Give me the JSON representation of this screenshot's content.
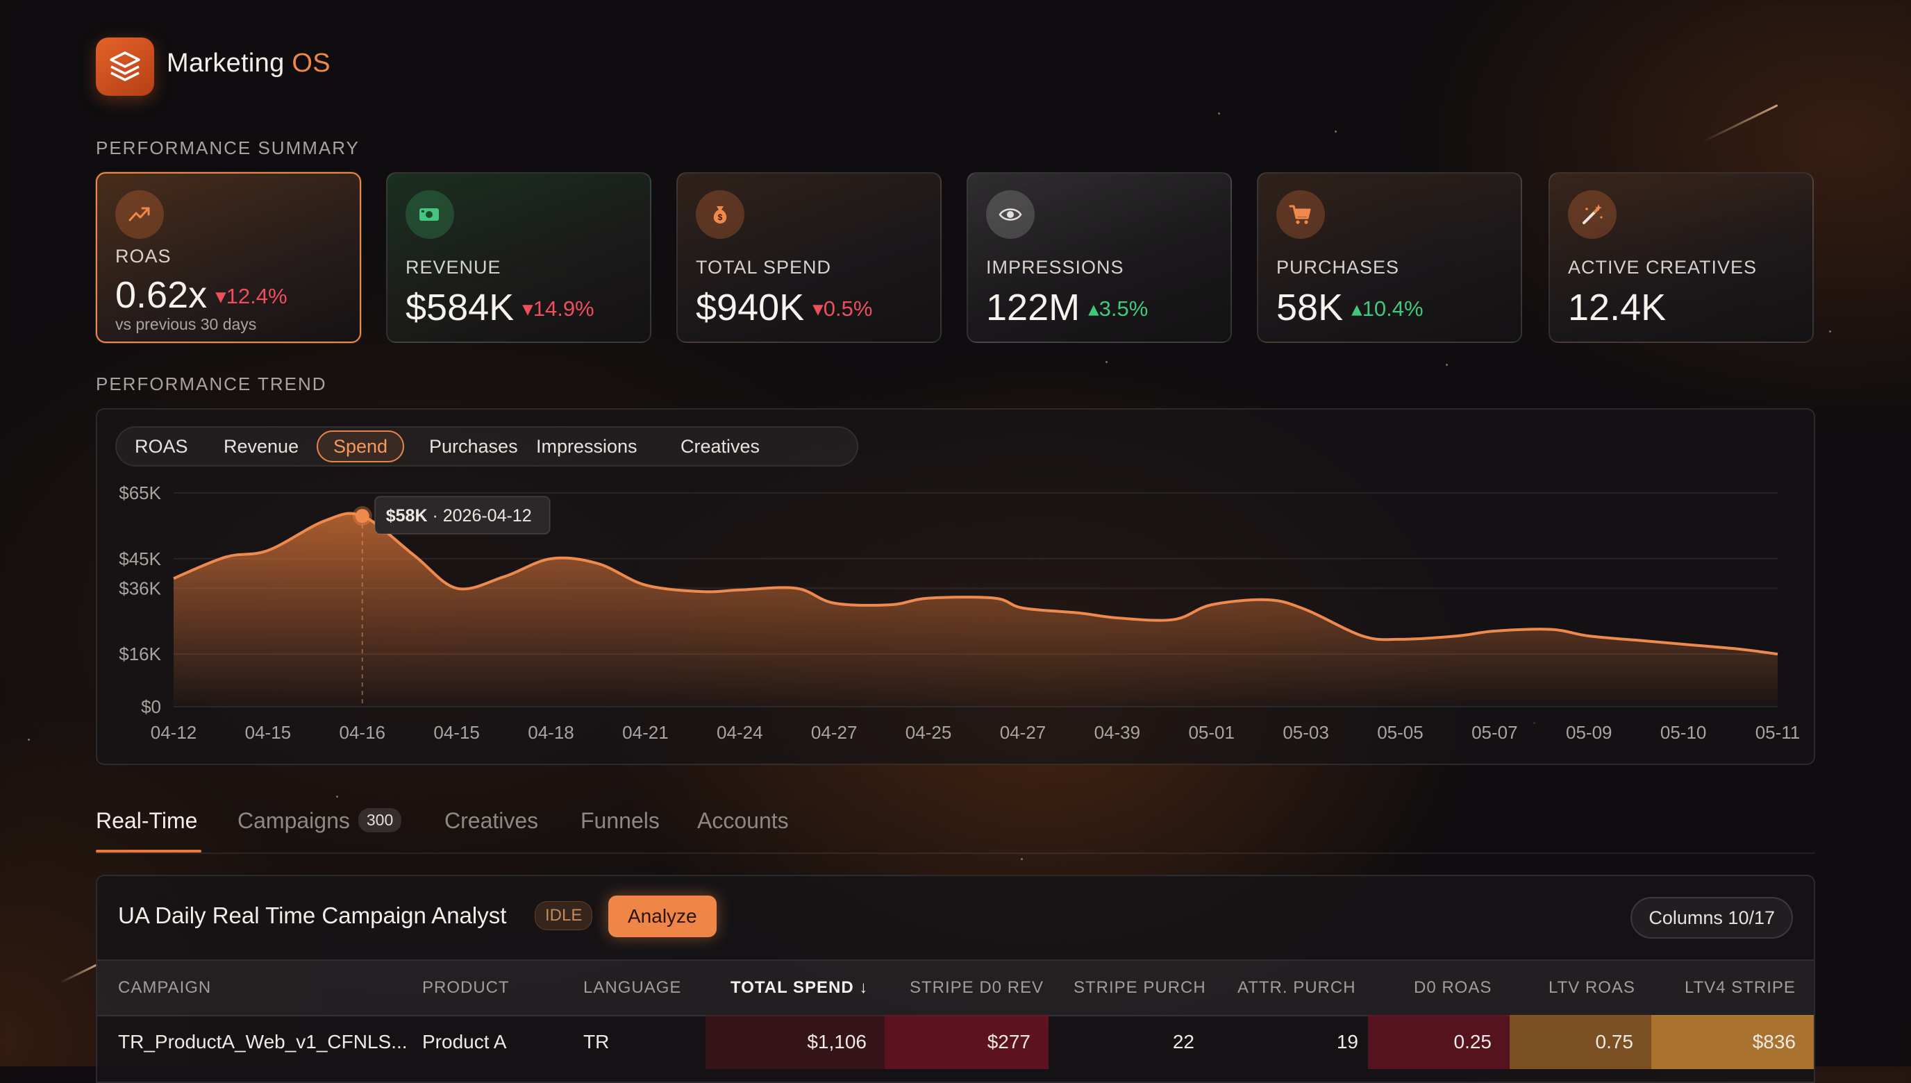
{
  "app": {
    "brand_main": "Marketing",
    "brand_accent": "OS",
    "logo_icon": "layers-icon"
  },
  "colors": {
    "accent": "#ef8547",
    "down": "#ee4f5c",
    "up": "#40c97a"
  },
  "summary": {
    "section_title": "PERFORMANCE SUMMARY",
    "kpis": [
      {
        "label": "ROAS",
        "value": "0.62x",
        "change": "12.4%",
        "direction": "down",
        "sub": "vs previous 30 days",
        "icon": "trending-up-icon"
      },
      {
        "label": "REVENUE",
        "value": "$584K",
        "change": "14.9%",
        "direction": "down",
        "icon": "cash-icon"
      },
      {
        "label": "TOTAL SPEND",
        "value": "$940K",
        "change": "0.5%",
        "direction": "down",
        "icon": "money-bag-icon"
      },
      {
        "label": "IMPRESSIONS",
        "value": "122M",
        "change": "3.5%",
        "direction": "up",
        "icon": "eye-icon"
      },
      {
        "label": "PURCHASES",
        "value": "58K",
        "change": "10.4%",
        "direction": "up",
        "icon": "cart-icon"
      },
      {
        "label": "ACTIVE CREATIVES",
        "value": "12.4K",
        "icon": "magic-wand-icon"
      }
    ]
  },
  "trend": {
    "section_title": "PERFORMANCE TREND",
    "tabs": [
      "ROAS",
      "Revenue",
      "Spend",
      "Purchases",
      "Impressions",
      "Creatives"
    ],
    "selected_tab": "Spend",
    "tooltip": {
      "value": "$58K",
      "separator": " · ",
      "date": "2026-04-12"
    }
  },
  "chart_data": {
    "type": "area",
    "x_labels": [
      "04-12",
      "04-15",
      "04-16",
      "04-15",
      "04-18",
      "04-21",
      "04-24",
      "04-27",
      "04-25",
      "04-27",
      "04-39",
      "05-01",
      "05-03",
      "05-05",
      "05-07",
      "05-09",
      "05-10",
      "05-11"
    ],
    "y_tick_labels": [
      "$65K",
      "$45K",
      "$36K",
      "$16K",
      "$0"
    ],
    "y_tick_values": [
      65,
      45,
      36,
      16,
      0
    ],
    "ylim": [
      0,
      65
    ],
    "y_unit": "$K",
    "grid": true,
    "series": [
      {
        "x": [
          0,
          0.55,
          1.0,
          1.6,
          2.0,
          2.55,
          3.0,
          3.5,
          4.0,
          4.5,
          5.0,
          5.6,
          6.0,
          6.6,
          7.0,
          7.6,
          8.0,
          8.7,
          9.0,
          9.6,
          10.0,
          10.6,
          11.0,
          11.6,
          12.0,
          12.6,
          13.0,
          13.6,
          14.0,
          14.6,
          15.0,
          15.6,
          16.0,
          16.6,
          17.0
        ],
        "y": [
          39,
          45.5,
          47.5,
          56.5,
          58,
          46,
          36,
          39.5,
          45,
          43.5,
          37,
          35,
          35.5,
          36,
          31.5,
          31,
          33,
          33,
          30,
          28.5,
          27,
          26.5,
          31,
          32.5,
          29.5,
          21.5,
          20.5,
          21.5,
          23,
          23.5,
          21.5,
          20,
          19,
          17.5,
          16
        ]
      }
    ],
    "highlight": {
      "x_label": "04-16",
      "value": 58
    }
  },
  "bottom_tabs": {
    "items": [
      {
        "label": "Real-Time"
      },
      {
        "label": "Campaigns",
        "count": "300"
      },
      {
        "label": "Creatives"
      },
      {
        "label": "Funnels"
      },
      {
        "label": "Accounts"
      }
    ],
    "selected": "Real-Time"
  },
  "table_panel": {
    "title": "UA Daily Real Time Campaign Analyst",
    "status": "IDLE",
    "analyze_label": "Analyze",
    "columns_label": "Columns 10/17",
    "headers": [
      "CAMPAIGN",
      "PRODUCT",
      "LANGUAGE",
      "TOTAL SPEND",
      "STRIPE D0 REV",
      "STRIPE PURCH",
      "ATTR. PURCH",
      "D0 ROAS",
      "LTV ROAS",
      "LTV4 STRIPE"
    ],
    "sorted_column": "TOTAL SPEND",
    "sort_direction": "descending",
    "rows": [
      [
        "TR_ProductA_Web_v1_CFNLS...",
        "Product A",
        "TR",
        "$1,106",
        "$277",
        "22",
        "19",
        "0.25",
        "0.75",
        "$836"
      ]
    ]
  }
}
